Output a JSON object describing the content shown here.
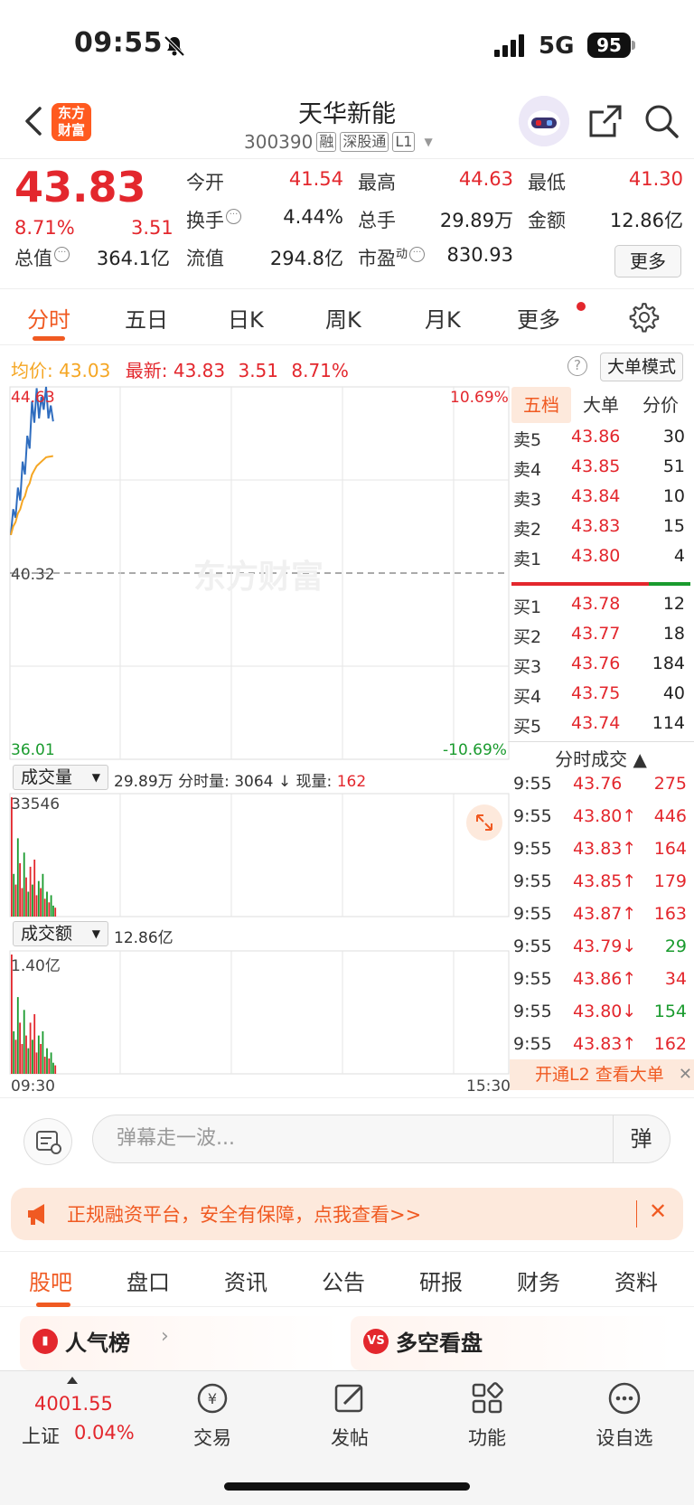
{
  "status": {
    "time": "09:55",
    "network": "5G",
    "battery": "95"
  },
  "header": {
    "logo_line1": "东方",
    "logo_line2": "财富",
    "name": "天华新能",
    "code": "300390",
    "tags": [
      "融",
      "深股通",
      "L1"
    ]
  },
  "quote": {
    "price": "43.83",
    "pct": "8.71%",
    "change": "3.51",
    "fields": [
      {
        "label": "今开",
        "value": "41.54"
      },
      {
        "label": "最高",
        "value": "44.63"
      },
      {
        "label": "最低",
        "value": "41.30"
      },
      {
        "label": "换手",
        "value": "4.44%"
      },
      {
        "label": "总手",
        "value": "29.89万"
      },
      {
        "label": "金额",
        "value": "12.86亿"
      },
      {
        "label": "总值",
        "value": "364.1亿"
      },
      {
        "label": "流值",
        "value": "294.8亿"
      },
      {
        "label": "市盈",
        "value": "830.93"
      }
    ],
    "pe_suffix": "动",
    "more": "更多"
  },
  "tabs": [
    "分时",
    "五日",
    "日K",
    "周K",
    "月K",
    "更多"
  ],
  "avgline": {
    "avg_label": "均价:",
    "avg": "43.03",
    "last_label": "最新:",
    "last": "43.83",
    "chg": "3.51",
    "pct": "8.71%",
    "help": "?",
    "mode": "大单模式"
  },
  "chart": {
    "watermark": "东方财富",
    "y_high": "44.63",
    "y_mid": "40.32",
    "y_low": "36.01",
    "pct_high": "10.69%",
    "pct_low": "-10.69%",
    "vol_selector": "成交量",
    "vol_info_total": "29.89万",
    "vol_info_label": "分时量:",
    "vol_info_val": "3064",
    "vol_info_arrow": "↓",
    "vol_now_label": "现量:",
    "vol_now": "162",
    "vol_max": "33546",
    "amt_selector": "成交额",
    "amt_total": "12.86亿",
    "amt_max": "1.40亿",
    "t_start": "09:30",
    "t_end": "15:30"
  },
  "chart_data": {
    "type": "line",
    "title": "",
    "series": [
      {
        "values": [
          41.2,
          41.8,
          41.6,
          42.3,
          42.0,
          42.9,
          42.6,
          43.5,
          43.2,
          44.3,
          43.8,
          44.6,
          43.9,
          44.4,
          44.1,
          44.63,
          43.9,
          44.2,
          43.83
        ]
      },
      {
        "values": [
          41.2,
          41.4,
          41.5,
          41.7,
          41.8,
          42.0,
          42.1,
          42.3,
          42.4,
          42.6,
          42.7,
          42.8,
          42.85,
          42.9,
          42.95,
          43.0,
          43.01,
          43.02,
          43.03
        ]
      }
    ],
    "ylim": [
      36.01,
      44.63
    ],
    "volume": [
      33546,
      12000,
      9000,
      22000,
      15000,
      8000,
      18000,
      11000,
      7000,
      14000,
      9000,
      16000,
      6000,
      10000,
      8000,
      12000,
      5000,
      7000,
      4000,
      6000,
      3064,
      2500
    ],
    "volume_up": [
      1,
      0,
      1,
      0,
      1,
      1,
      0,
      1,
      0,
      1,
      0,
      1,
      1,
      0,
      1,
      0,
      1,
      0,
      1,
      0,
      0,
      1
    ],
    "amount": [
      1.4,
      0.5,
      0.4,
      0.9,
      0.6,
      0.35,
      0.75,
      0.45,
      0.3,
      0.6,
      0.4,
      0.7,
      0.25,
      0.45,
      0.35,
      0.5,
      0.2,
      0.3,
      0.18,
      0.25,
      0.13,
      0.1
    ]
  },
  "book": {
    "tabs": [
      "五档",
      "大单",
      "分价"
    ],
    "asks": [
      {
        "k": "卖5",
        "p": "43.86",
        "v": "30"
      },
      {
        "k": "卖4",
        "p": "43.85",
        "v": "51"
      },
      {
        "k": "卖3",
        "p": "43.84",
        "v": "10"
      },
      {
        "k": "卖2",
        "p": "43.83",
        "v": "15"
      },
      {
        "k": "卖1",
        "p": "43.80",
        "v": "4"
      }
    ],
    "bids": [
      {
        "k": "买1",
        "p": "43.78",
        "v": "12"
      },
      {
        "k": "买2",
        "p": "43.77",
        "v": "18"
      },
      {
        "k": "买3",
        "p": "43.76",
        "v": "184"
      },
      {
        "k": "买4",
        "p": "43.75",
        "v": "40"
      },
      {
        "k": "买5",
        "p": "43.74",
        "v": "114"
      }
    ],
    "ticks_title": "分时成交 ▲",
    "ticks": [
      {
        "t": "9:55",
        "p": "43.76",
        "v": "275",
        "dir": ""
      },
      {
        "t": "9:55",
        "p": "43.80↑",
        "v": "446",
        "dir": "up"
      },
      {
        "t": "9:55",
        "p": "43.83↑",
        "v": "164",
        "dir": "up"
      },
      {
        "t": "9:55",
        "p": "43.85↑",
        "v": "179",
        "dir": "up"
      },
      {
        "t": "9:55",
        "p": "43.87↑",
        "v": "163",
        "dir": "up"
      },
      {
        "t": "9:55",
        "p": "43.79↓",
        "v": "29",
        "dir": "down"
      },
      {
        "t": "9:55",
        "p": "43.86↑",
        "v": "34",
        "dir": "up"
      },
      {
        "t": "9:55",
        "p": "43.80↓",
        "v": "154",
        "dir": "down"
      },
      {
        "t": "9:55",
        "p": "43.83↑",
        "v": "162",
        "dir": "up"
      }
    ],
    "l2": "开通L2 查看大单",
    "l2_close": "✕"
  },
  "danmu": {
    "placeholder": "弹幕走一波...",
    "button": "弹"
  },
  "ad": {
    "text": "正规融资平台，安全有保障，点我查看>>",
    "close": "✕"
  },
  "subtabs": [
    "股吧",
    "盘口",
    "资讯",
    "公告",
    "研报",
    "财务",
    "资料"
  ],
  "cards": [
    {
      "title": "人气榜",
      "icon": "bar-chart-icon"
    },
    {
      "title": "多空看盘",
      "icon": "vs-icon",
      "icon_text": "VS"
    }
  ],
  "bottomnav": {
    "index_value": "4001.55",
    "index_name": "上证",
    "index_pct": "0.04%",
    "items": [
      "交易",
      "发帖",
      "功能",
      "设自选"
    ]
  },
  "colors": {
    "accent": "#f05a22",
    "up": "#e3272d",
    "down": "#1a9b2e",
    "avg": "#f5a623",
    "line": "#2f6dbf"
  }
}
